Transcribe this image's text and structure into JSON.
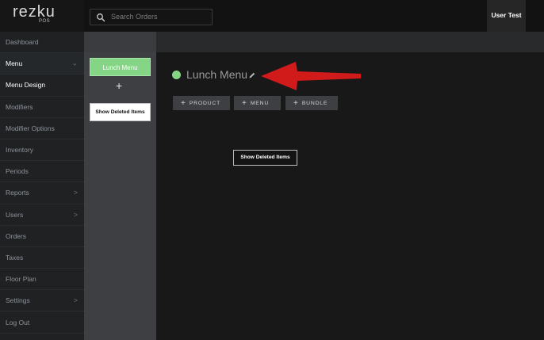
{
  "brand": {
    "name": "rezku",
    "sub": "POS"
  },
  "search": {
    "placeholder": "Search Orders"
  },
  "user": {
    "name": "User Test"
  },
  "sidebar": {
    "items": [
      {
        "label": "Dashboard",
        "chevron": ""
      },
      {
        "label": "Menu",
        "chevron": "⌄"
      },
      {
        "label": "Menu Design",
        "chevron": ""
      },
      {
        "label": "Modifiers",
        "chevron": ""
      },
      {
        "label": "Modifier Options",
        "chevron": ""
      },
      {
        "label": "Inventory",
        "chevron": ""
      },
      {
        "label": "Periods",
        "chevron": ""
      },
      {
        "label": "Reports",
        "chevron": ">"
      },
      {
        "label": "Users",
        "chevron": ">"
      },
      {
        "label": "Orders",
        "chevron": ""
      },
      {
        "label": "Taxes",
        "chevron": ""
      },
      {
        "label": "Floor Plan",
        "chevron": ""
      },
      {
        "label": "Settings",
        "chevron": ">"
      },
      {
        "label": "Log Out",
        "chevron": ""
      }
    ]
  },
  "menus_column": {
    "menu_button": "Lunch Menu",
    "add_label": "+",
    "show_deleted": "Show Deleted Items"
  },
  "main": {
    "title": "Lunch Menu",
    "buttons": [
      {
        "plus": "+",
        "label": "PRODUCT"
      },
      {
        "plus": "+",
        "label": "MENU"
      },
      {
        "plus": "+",
        "label": "BUNDLE"
      }
    ],
    "show_deleted": "Show Deleted Items"
  },
  "colors": {
    "accent_green": "#85d586",
    "arrow_red": "#d11a1a",
    "sidebar_bg": "#1f2123",
    "column_bg": "#3d3f42",
    "main_bg": "#181818"
  },
  "icons": [
    "search-icon",
    "pencil-icon",
    "chevron-down-icon",
    "chevron-right-icon",
    "red-arrow-annotation"
  ]
}
